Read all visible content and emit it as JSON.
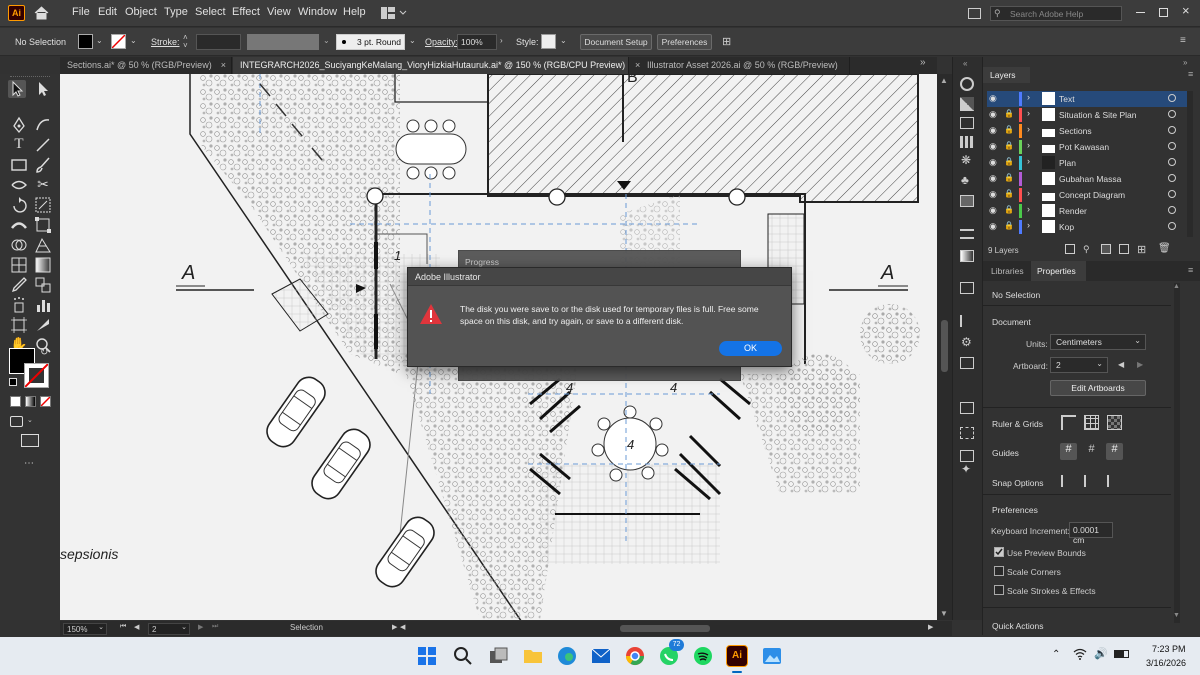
{
  "menu": {
    "app_logo": "Ai",
    "items": [
      "File",
      "Edit",
      "Object",
      "Type",
      "Select",
      "Effect",
      "View",
      "Window",
      "Help"
    ],
    "search_placeholder": "Search Adobe Help"
  },
  "control_bar": {
    "selection": "No Selection",
    "stroke_label": "Stroke:",
    "brush": "3 pt. Round",
    "opacity_label": "Opacity:",
    "opacity_value": "100%",
    "style_label": "Style:",
    "document_setup": "Document Setup",
    "preferences": "Preferences"
  },
  "tabs": [
    {
      "label": "Sections.ai* @ 50 % (RGB/Preview)"
    },
    {
      "label": "INTEGRARCH2026_SuciyangKeMalang_VioryHizkiaHutauruk.ai* @ 150 % (RGB/CPU Preview)"
    },
    {
      "label": "Illustrator Asset 2026.ai @ 50 % (RGB/Preview)"
    }
  ],
  "canvas": {
    "section_marker": "A",
    "label_1": "1",
    "label_4": "4",
    "label_b": "B",
    "room_label": "sepsionis"
  },
  "progress_title": "Progress",
  "dialog": {
    "title": "Adobe Illustrator",
    "message": "The disk you were save to or the disk used for temporary files is full. Free some space on this disk, and try again, or save to a different disk.",
    "ok": "OK"
  },
  "layers_panel": {
    "title": "Layers",
    "layers": [
      {
        "name": "Text",
        "color": "#4f7bff"
      },
      {
        "name": "Situation & Site Plan",
        "color": "#ff5050"
      },
      {
        "name": "Sections",
        "color": "#ff8a1e"
      },
      {
        "name": "Pot Kawasan",
        "color": "#6ad15a"
      },
      {
        "name": "Plan",
        "color": "#36c3d8"
      },
      {
        "name": "Gubahan Massa",
        "color": "#b25bd6"
      },
      {
        "name": "Concept Diagram",
        "color": "#ff5050"
      },
      {
        "name": "Render",
        "color": "#4ac94a"
      },
      {
        "name": "Kop",
        "color": "#4f7bff"
      }
    ],
    "count": "9 Layers"
  },
  "properties_panel": {
    "tab_libraries": "Libraries",
    "tab_properties": "Properties",
    "selection": "No Selection",
    "document": "Document",
    "units_label": "Units:",
    "units_value": "Centimeters",
    "artboard_label": "Artboard:",
    "artboard_value": "2",
    "edit_artboards": "Edit Artboards",
    "ruler_grids": "Ruler & Grids",
    "guides": "Guides",
    "snap_options": "Snap Options",
    "preferences": "Preferences",
    "keyboard_increment_label": "Keyboard Increment:",
    "keyboard_increment_value": "0.0001 cm",
    "use_preview_bounds": "Use Preview Bounds",
    "scale_corners": "Scale Corners",
    "scale_strokes": "Scale Strokes & Effects",
    "quick_actions": "Quick Actions"
  },
  "status_bar": {
    "zoom": "150%",
    "artboard": "2",
    "tool": "Selection"
  },
  "taskbar": {
    "whatsapp_badge": "72",
    "time": "7:23 PM",
    "date": "3/16/2026"
  }
}
